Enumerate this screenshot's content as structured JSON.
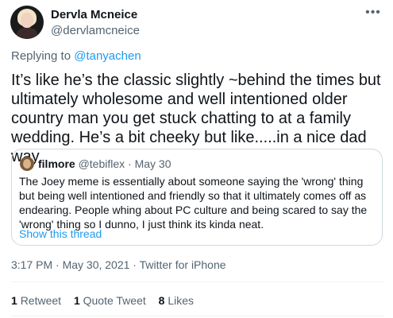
{
  "author": {
    "name": "Dervla Mcneice",
    "handle": "@dervlamcneice"
  },
  "more_icon": "more-horizontal-icon",
  "reply": {
    "prefix": "Replying to ",
    "handle": "@tanyachen"
  },
  "tweet_text": "It’s like he’s the classic slightly ~behind the times but ultimately wholesome and well intentioned older country man you get stuck chatting to at a family wedding. He’s a bit cheeky but like.....in a nice dad way",
  "quote": {
    "name": "filmore",
    "handle_date": "@tebiflex · May 30",
    "text": "The Joey meme is essentially about someone saying the 'wrong' thing but being well intentioned and friendly so that it ultimately comes off as endearing. People whing about PC culture and being scared to say the 'wrong' thing so I dunno, I just think its kinda neat.",
    "show_thread": "Show this thread"
  },
  "meta": "3:17 PM · May 30, 2021 · Twitter for iPhone",
  "stats": {
    "retweets_count": "1",
    "retweets_label": "Retweet",
    "quotes_count": "1",
    "quotes_label": "Quote Tweet",
    "likes_count": "8",
    "likes_label": "Likes"
  },
  "colors": {
    "link": "#1d9bf0",
    "secondary_text": "#536471",
    "border": "#cfd9de"
  }
}
